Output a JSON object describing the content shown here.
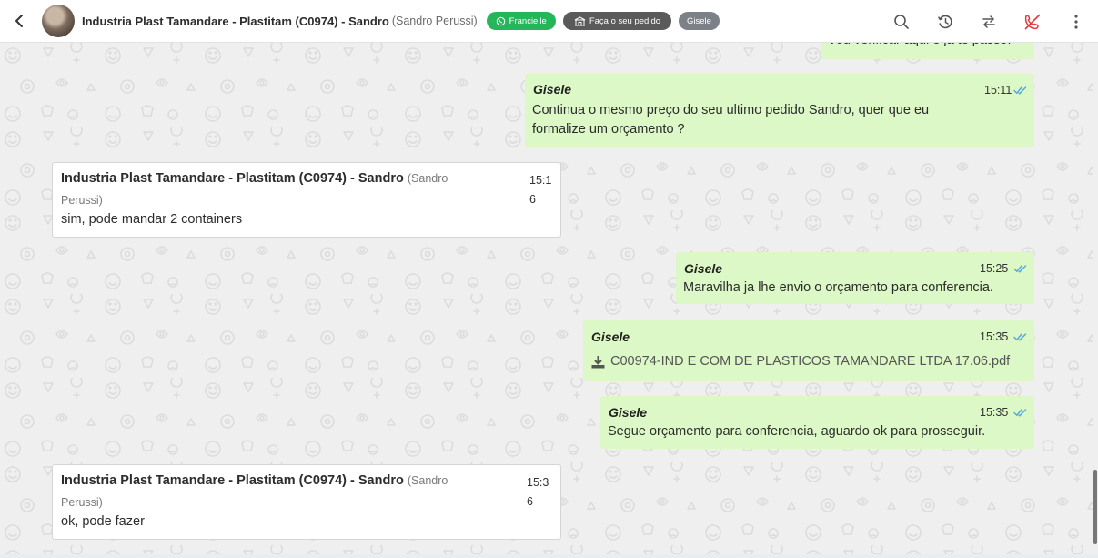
{
  "header": {
    "title": "Industria Plast Tamandare - Plastitam (C0974) - Sandro",
    "subtitle": "(Sandro Perussi)",
    "tags": {
      "agent": "Francielle",
      "order": "Faça o seu pedido",
      "user": "Gisele"
    }
  },
  "colors": {
    "outgoing": "#dcf8c6",
    "incoming": "#ffffff",
    "whatsapp": "#25b65a",
    "read_ticks": "#4fa7e0",
    "danger": "#e03b3b"
  },
  "messages": {
    "m0": {
      "text": "Vou verificar aqui e ja te passo."
    },
    "m1": {
      "sender": "Gisele",
      "time": "15:11",
      "line1": "Continua o mesmo preço do seu ultimo pedido Sandro, quer que eu",
      "line2": "formalize um orçamento ?"
    },
    "m2": {
      "sender": "Industria Plast Tamandare - Plastitam (C0974) - Sandro",
      "sender_user_a": "(Sandro",
      "sender_user_b": "Perussi)",
      "time_a": "15:1",
      "time_b": "6",
      "text": "sim, pode mandar 2 containers"
    },
    "m3": {
      "sender": "Gisele",
      "time": "15:25",
      "text": "Maravilha ja lhe envio o orçamento para conferencia."
    },
    "m4": {
      "sender": "Gisele",
      "time": "15:35",
      "file": "C00974-IND E COM DE PLASTICOS TAMANDARE LTDA 17.06.pdf"
    },
    "m5": {
      "sender": "Gisele",
      "time": "15:35",
      "text": "Segue orçamento para conferencia, aguardo ok para prosseguir."
    },
    "m6": {
      "sender": "Industria Plast Tamandare - Plastitam (C0974) - Sandro",
      "sender_user_a": "(Sandro",
      "sender_user_b": "Perussi)",
      "time_a": "15:3",
      "time_b": "6",
      "text": "ok, pode fazer"
    }
  }
}
